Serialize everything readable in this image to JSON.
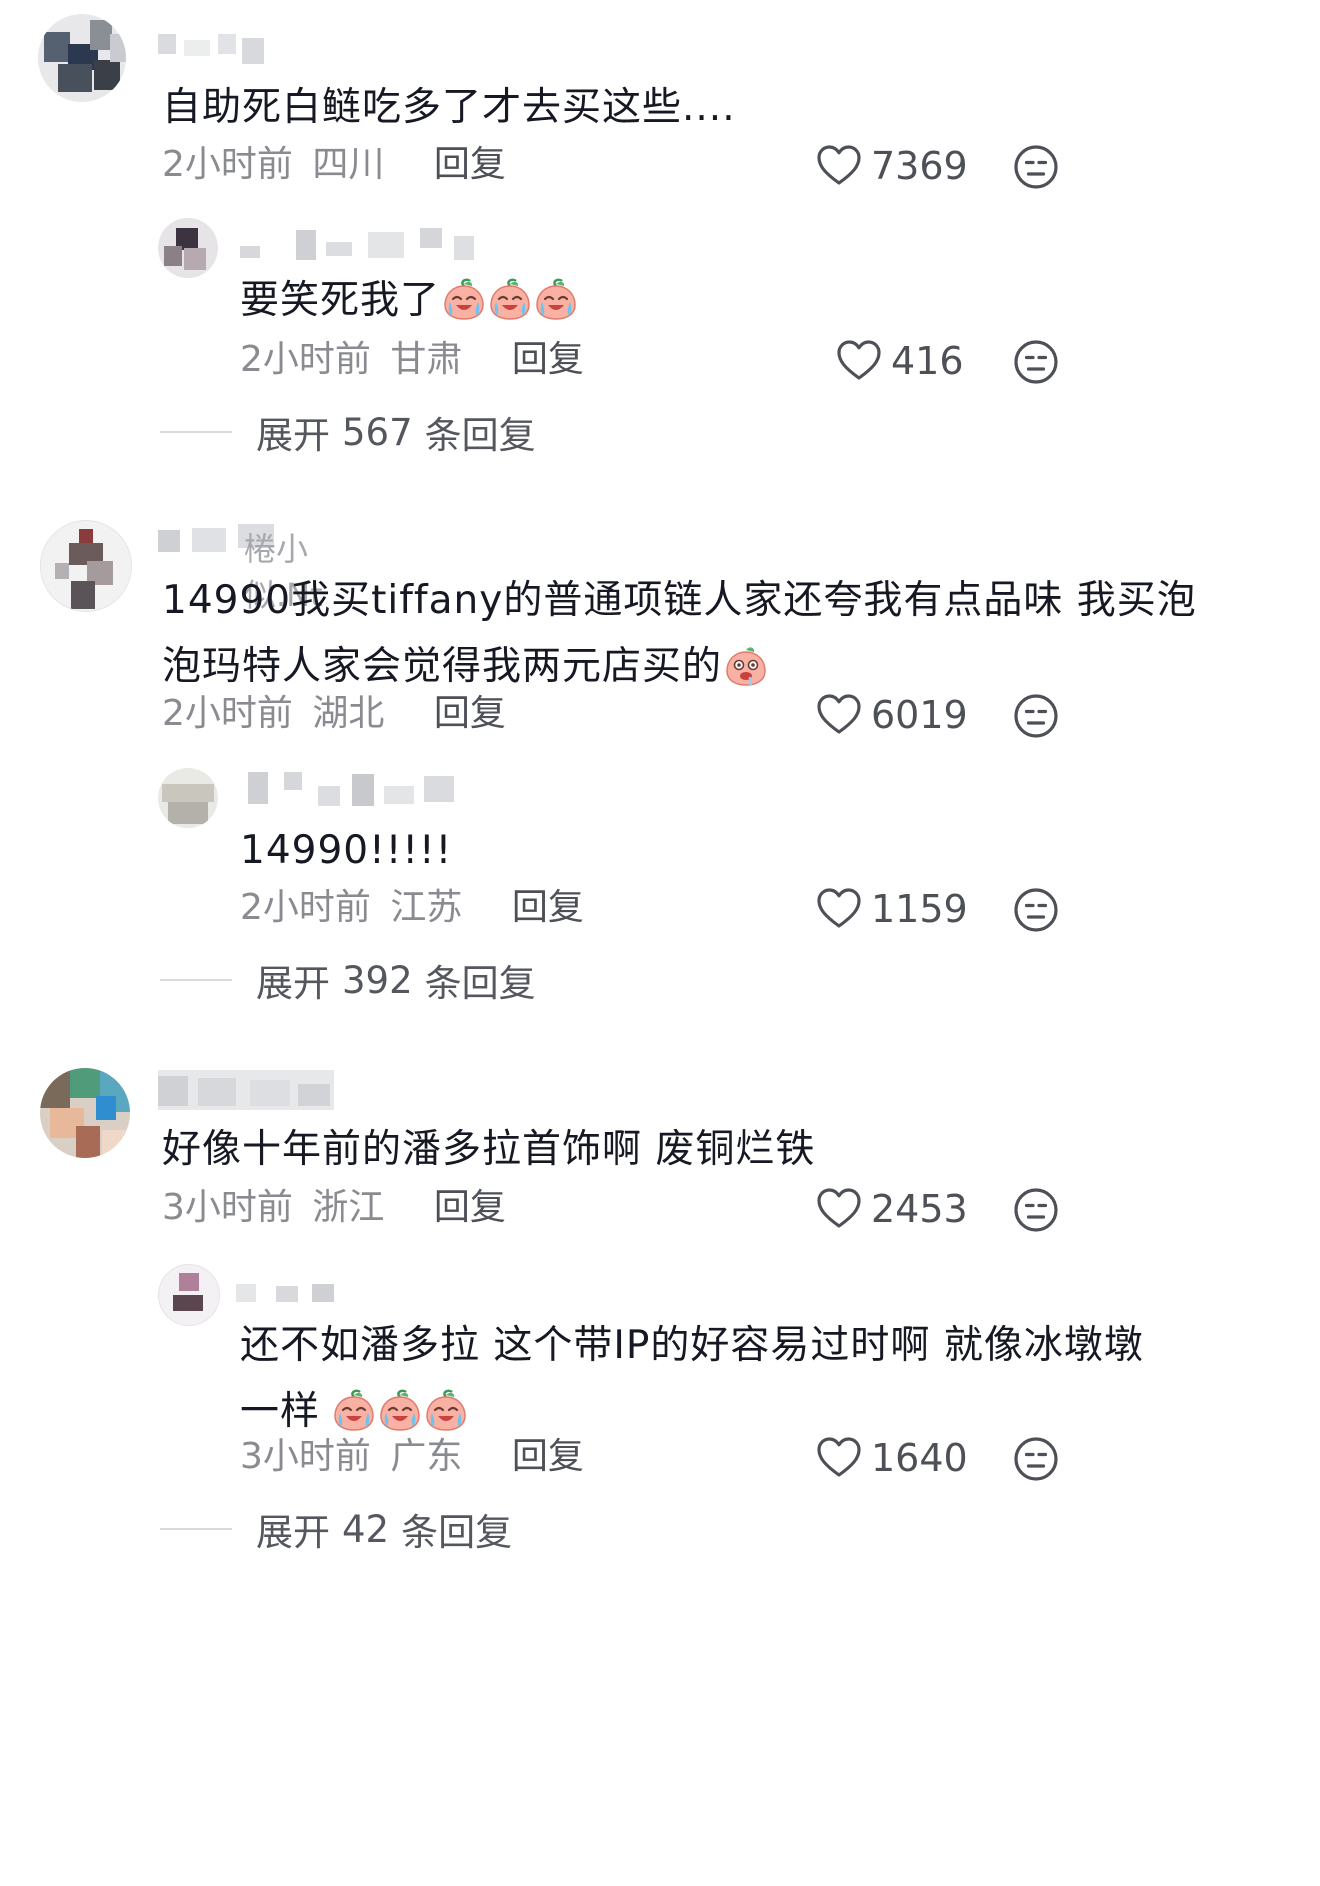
{
  "comments": [
    {
      "text": "自助死白鲢吃多了才去买这些....",
      "time": "2小时前",
      "location": "四川",
      "reply_label": "回复",
      "likes": "7369",
      "replies": [
        {
          "text": "要笑死我了",
          "emoji": "crying-laughing-peach-emoji x3",
          "time": "2小时前",
          "location": "甘肃",
          "reply_label": "回复",
          "likes": "416"
        }
      ],
      "expand_prefix": "展开",
      "expand_count": "567",
      "expand_suffix": "条回复"
    },
    {
      "username_visible": "棬小似.Nt",
      "text_line1": "14990我买tiffany的普通项链人家还夸我有点品味 我买泡",
      "text_line2": "泡玛特人家会觉得我两元店买的",
      "emoji": "drooling-peach-emoji",
      "time": "2小时前",
      "location": "湖北",
      "reply_label": "回复",
      "likes": "6019",
      "replies": [
        {
          "text": "14990!!!!!",
          "time": "2小时前",
          "location": "江苏",
          "reply_label": "回复",
          "likes": "1159"
        }
      ],
      "expand_prefix": "展开",
      "expand_count": "392",
      "expand_suffix": "条回复"
    },
    {
      "text": "好像十年前的潘多拉首饰啊 废铜烂铁",
      "time": "3小时前",
      "location": "浙江",
      "reply_label": "回复",
      "likes": "2453",
      "replies": [
        {
          "text_line1": "还不如潘多拉 这个带IP的好容易过时啊 就像冰墩墩",
          "text_line2": "一样",
          "emoji": "crying-laughing-peach-emoji x3",
          "time": "3小时前",
          "location": "广东",
          "reply_label": "回复",
          "likes": "1640"
        }
      ],
      "expand_prefix": "展开",
      "expand_count": "42",
      "expand_suffix": "条回复"
    }
  ],
  "icons": {
    "like": "heart-outline-icon",
    "dislike": "neutral-face-icon"
  },
  "colors": {
    "text_primary": "#161823",
    "text_secondary": "#8a8b91",
    "reply_link": "#4e5058",
    "emoji_peach": "#f6a79b"
  }
}
